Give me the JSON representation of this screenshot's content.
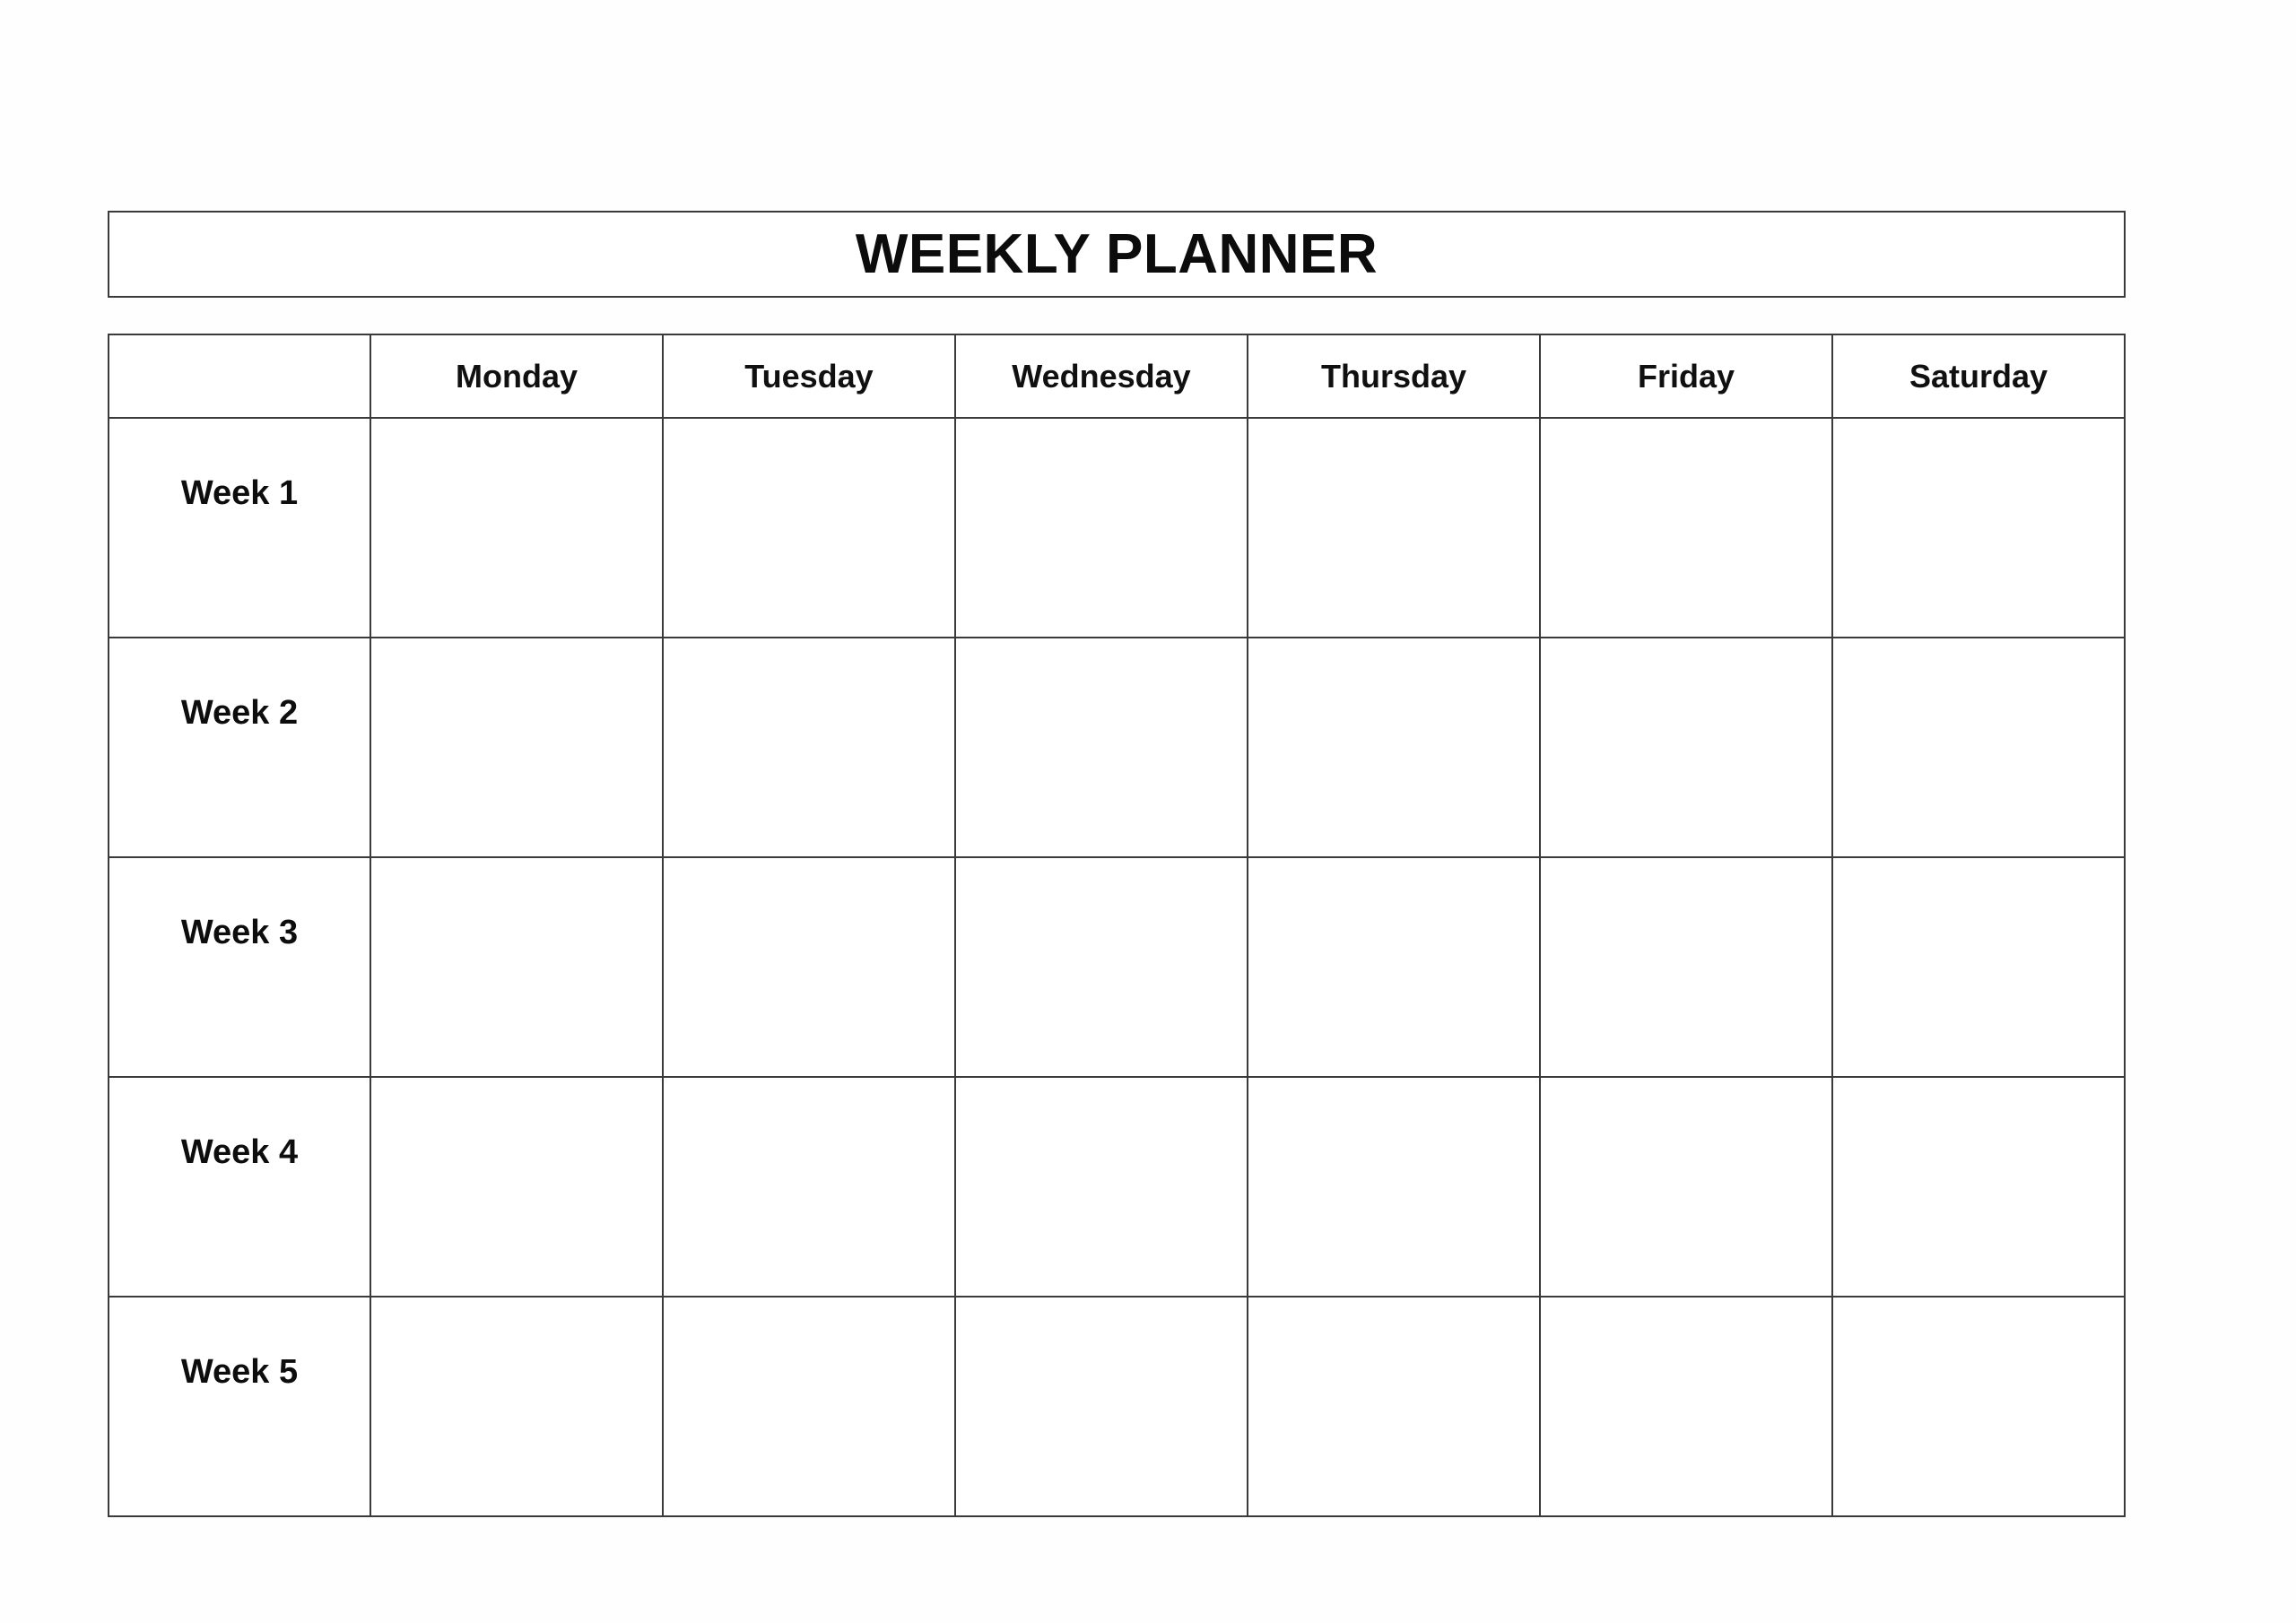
{
  "document": {
    "title": "WEEKLY PLANNER",
    "background_color": "#fefefe",
    "border_color": "#3a3a3a",
    "text_color": "#0c0c0c"
  },
  "header": {
    "title_label": "WEEKLY PLANNER"
  },
  "table": {
    "corner_header": "",
    "day_columns": [
      {
        "label": "Monday"
      },
      {
        "label": "Tuesday"
      },
      {
        "label": "Wednesday"
      },
      {
        "label": "Thursday"
      },
      {
        "label": "Friday"
      },
      {
        "label": "Saturday"
      }
    ],
    "rows": [
      {
        "label": "Week 1",
        "cells": [
          "",
          "",
          "",
          "",
          "",
          ""
        ]
      },
      {
        "label": "Week 2",
        "cells": [
          "",
          "",
          "",
          "",
          "",
          ""
        ]
      },
      {
        "label": "Week 3",
        "cells": [
          "",
          "",
          "",
          "",
          "",
          ""
        ]
      },
      {
        "label": "Week 4",
        "cells": [
          "",
          "",
          "",
          "",
          "",
          ""
        ]
      },
      {
        "label": "Week 5",
        "cells": [
          "",
          "",
          "",
          "",
          "",
          ""
        ]
      }
    ]
  }
}
